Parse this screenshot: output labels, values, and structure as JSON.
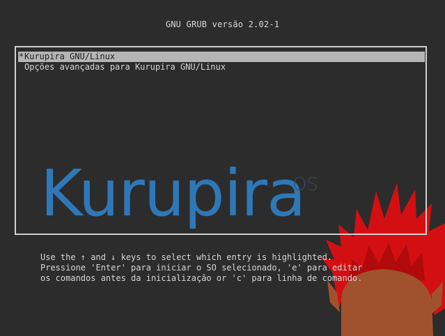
{
  "title": "GNU GRUB versão 2.02-1",
  "menu": {
    "items": [
      {
        "label": "Kurupira GNU/Linux",
        "selected": true
      },
      {
        "label": "Opções avançadas para Kurupira GNU/Linux",
        "selected": false
      }
    ]
  },
  "logo": {
    "text": "Kurupira",
    "superscript": "OS",
    "color": "#2f78b8"
  },
  "help": {
    "line1": "Use the ↑ and ↓ keys to select which entry is highlighted.",
    "line2": "Pressione 'Enter' para iniciar o SO selecionado, 'e' para editar",
    "line3": "os comandos antes da inicialização or 'c' para linha de comando."
  },
  "mascot": {
    "name": "kurupira-mascot",
    "hair_color": "#d40f12",
    "skin_color": "#a0522d"
  }
}
